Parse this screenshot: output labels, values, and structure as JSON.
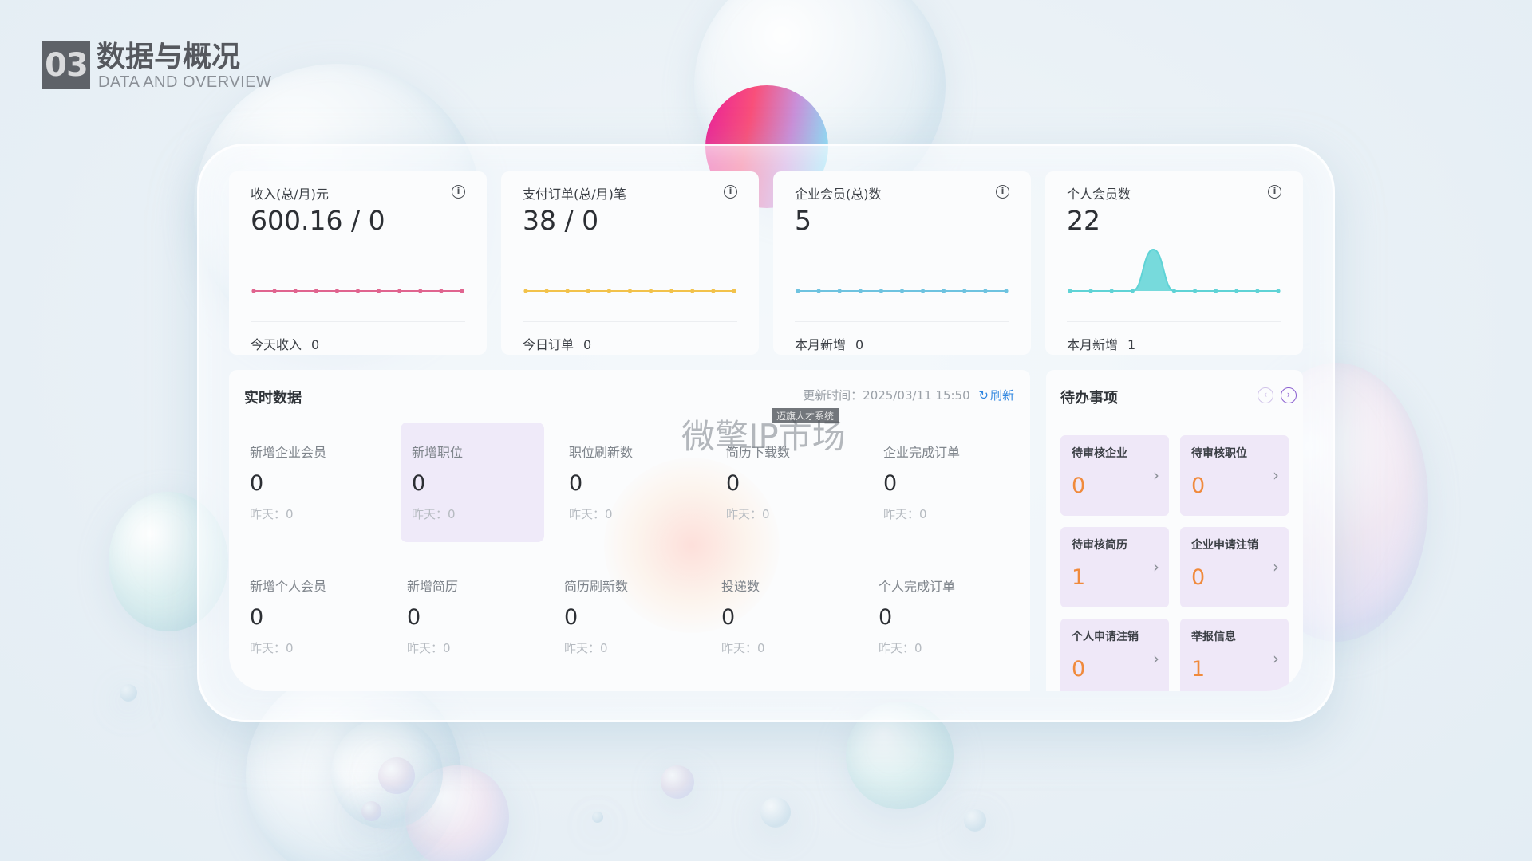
{
  "section": {
    "number": "03",
    "title_cn": "数据与概况",
    "title_en": "DATA AND OVERVIEW"
  },
  "colors": {
    "income_line": "#e0648f",
    "orders_line": "#f2c24b",
    "enterprise_line": "#6ec3e0",
    "personal_line": "#5fd3d6",
    "todo_value": "#f08a3c",
    "refresh": "#2f86e0",
    "highlight_bg": "#efeaf9"
  },
  "stats": [
    {
      "title": "收入(总/月)元",
      "value": "600.16 / 0",
      "foot_label": "今天收入",
      "foot_value": "0",
      "series": [
        0,
        0,
        0,
        0,
        0,
        0,
        0,
        0,
        0,
        0,
        0
      ]
    },
    {
      "title": "支付订单(总/月)笔",
      "value": "38 / 0",
      "foot_label": "今日订单",
      "foot_value": "0",
      "series": [
        0,
        0,
        0,
        0,
        0,
        0,
        0,
        0,
        0,
        0,
        0
      ]
    },
    {
      "title": "企业会员(总)数",
      "value": "5",
      "foot_label": "本月新增",
      "foot_value": "0",
      "series": [
        0,
        0,
        0,
        0,
        0,
        0,
        0,
        0,
        0,
        0,
        0
      ]
    },
    {
      "title": "个人会员数",
      "value": "22",
      "foot_label": "本月新增",
      "foot_value": "1",
      "series": [
        0,
        0,
        0,
        0,
        1,
        0,
        0,
        0,
        0,
        0,
        0
      ]
    }
  ],
  "realtime": {
    "title": "实时数据",
    "update_label": "更新时间：2025/03/11 15:50",
    "refresh_label": "刷新",
    "watermark": "微擎IP市场",
    "watermark_tag": "迈旗人才系统",
    "metrics": [
      {
        "label": "新增企业会员",
        "value": "0",
        "prev": "昨天：0"
      },
      {
        "label": "新增职位",
        "value": "0",
        "prev": "昨天：0"
      },
      {
        "label": "职位刷新数",
        "value": "0",
        "prev": "昨天：0"
      },
      {
        "label": "简历下载数",
        "value": "0",
        "prev": "昨天：0"
      },
      {
        "label": "企业完成订单",
        "value": "0",
        "prev": "昨天：0"
      },
      {
        "label": "新增个人会员",
        "value": "0",
        "prev": "昨天：0"
      },
      {
        "label": "新增简历",
        "value": "0",
        "prev": "昨天：0"
      },
      {
        "label": "简历刷新数",
        "value": "0",
        "prev": "昨天：0"
      },
      {
        "label": "投递数",
        "value": "0",
        "prev": "昨天：0"
      },
      {
        "label": "个人完成订单",
        "value": "0",
        "prev": "昨天：0"
      }
    ]
  },
  "todo": {
    "title": "待办事项",
    "items": [
      {
        "label": "待审核企业",
        "value": "0"
      },
      {
        "label": "待审核职位",
        "value": "0"
      },
      {
        "label": "待审核简历",
        "value": "1"
      },
      {
        "label": "企业申请注销",
        "value": "0"
      },
      {
        "label": "个人申请注销",
        "value": "0"
      },
      {
        "label": "举报信息",
        "value": "1"
      }
    ]
  }
}
